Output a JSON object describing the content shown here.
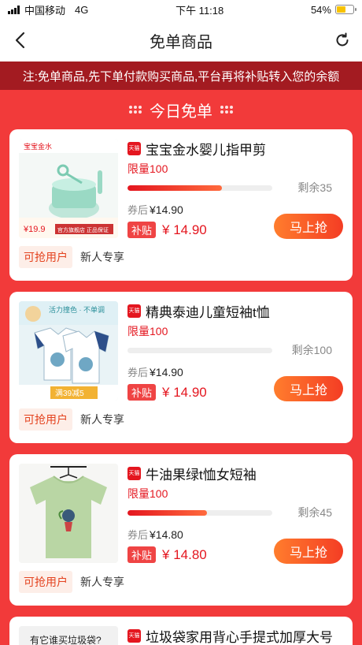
{
  "status": {
    "carrier": "中国移动",
    "network": "4G",
    "time": "下午 11:18",
    "battery": "54%"
  },
  "nav": {
    "title": "免单商品"
  },
  "notice": "注:免单商品,先下单付款购买商品,平台再将补贴转入您的余额",
  "section": {
    "title": "今日免单"
  },
  "common": {
    "after_label": "券后",
    "subsidy_label": "补贴",
    "grab_label": "马上抢",
    "user_tag": "可抢用户",
    "new_tag": "新人专享",
    "tmall_text": "天猫"
  },
  "colors": {
    "accent": "#e4161f",
    "background": "#f23a3a",
    "notice_bg": "#a31b21"
  },
  "products": [
    {
      "title": "宝宝金水婴儿指甲剪",
      "limit": "限量100",
      "remain": "剩余35",
      "progress": 0.65,
      "after_price": "¥14.90",
      "subsidy_price": "¥ 14.90"
    },
    {
      "title": "精典泰迪儿童短袖t恤",
      "limit": "限量100",
      "remain": "剩余100",
      "progress": 0.0,
      "after_price": "¥14.90",
      "subsidy_price": "¥ 14.90"
    },
    {
      "title": "牛油果绿t恤女短袖",
      "limit": "限量100",
      "remain": "剩余45",
      "progress": 0.55,
      "after_price": "¥14.80",
      "subsidy_price": "¥ 14.80"
    },
    {
      "title": "垃圾袋家用背心手提式加厚大号"
    }
  ],
  "thumb_texts": {
    "p1_banner": "宝宝金水",
    "p1_price": "¥19.9",
    "p1_shop": "官方旗舰店 正品保证",
    "p2_banner": "活力撞色 · 不单调",
    "p2_deal": "满39减5",
    "p4_banner": "有它谁买垃圾袋?"
  }
}
